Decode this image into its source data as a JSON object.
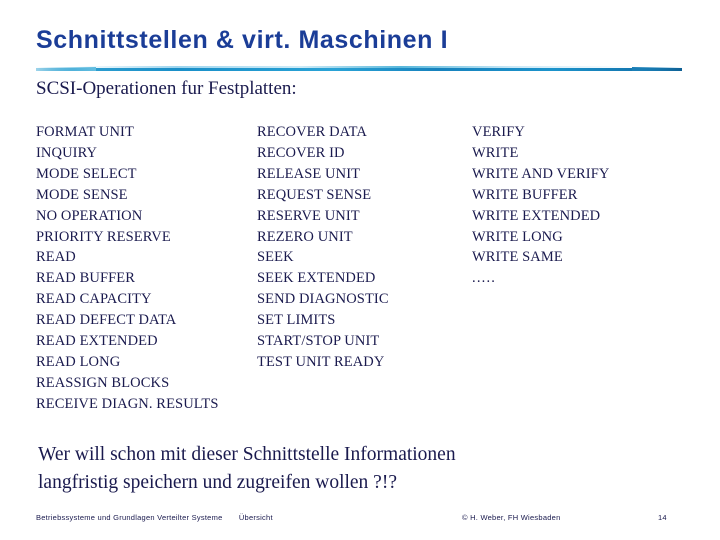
{
  "slide": {
    "title": "Schnittstellen & virt. Maschinen I",
    "subtitle": "SCSI-Operationen fur Festplatten:",
    "title_color": "#1b3d97",
    "body_color": "#1a1a4e",
    "rule_color": "#1a8fc8"
  },
  "columns": [
    {
      "name": "column-1",
      "items": [
        "FORMAT UNIT",
        "INQUIRY",
        "MODE SELECT",
        "MODE SENSE",
        "NO OPERATION",
        "PRIORITY RESERVE",
        "READ",
        "READ BUFFER",
        "READ CAPACITY",
        "READ DEFECT DATA",
        "READ EXTENDED",
        "READ LONG",
        "REASSIGN BLOCKS",
        "RECEIVE DIAGN. RESULTS"
      ]
    },
    {
      "name": "column-2",
      "items": [
        "RECOVER DATA",
        "RECOVER ID",
        "RELEASE UNIT",
        "REQUEST SENSE",
        "RESERVE UNIT",
        "REZERO UNIT",
        "SEEK",
        "SEEK EXTENDED",
        "SEND DIAGNOSTIC",
        "SET LIMITS",
        "START/STOP UNIT",
        "TEST UNIT READY"
      ]
    },
    {
      "name": "column-3",
      "items": [
        "VERIFY",
        "WRITE",
        "WRITE AND VERIFY",
        "WRITE BUFFER",
        "WRITE EXTENDED",
        "WRITE LONG",
        "WRITE SAME",
        "....."
      ]
    }
  ],
  "closing": {
    "line1": "Wer will schon mit dieser Schnittstelle Informationen",
    "line2": "langfristig speichern und zugreifen wollen ?!?"
  },
  "footer": {
    "course": "Betriebssysteme und Grundlagen Verteilter Systeme",
    "section": "Übersicht",
    "copyright": "© H. Weber, FH Wiesbaden",
    "page": "14"
  }
}
